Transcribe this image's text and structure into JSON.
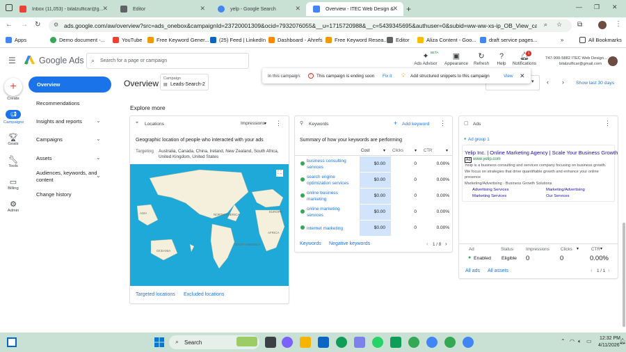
{
  "browser": {
    "tabs": [
      {
        "title": "Inbox (11,053) - bilalzulficar@g...",
        "color": "#ea4335"
      },
      {
        "title": "Editor",
        "color": "#5f6368"
      },
      {
        "title": "yelp - Google Search",
        "color": "#4285f4"
      },
      {
        "title": "Overview - ITEC Web Design &...",
        "color": "#4285f4"
      }
    ],
    "url": "ads.google.com/aw/overview?src=ads_onebox&campaignId=23720001309&ocid=7932076055&__u=1715720988&__c=5439345695&authuser=0&subid=ww-ww-xs-ip_OB_View_campaign",
    "bookmarks": [
      {
        "label": "Apps",
        "color": "#4285f4"
      },
      {
        "label": "Demo document -...",
        "color": "#34a853"
      },
      {
        "label": "YouTube",
        "color": "#ea4335"
      },
      {
        "label": "Free Keyword Gener...",
        "color": "#f29900"
      },
      {
        "label": "(25) Feed | LinkedIn",
        "color": "#0a66c2"
      },
      {
        "label": "Dashboard - Ahrefs",
        "color": "#ff8800"
      },
      {
        "label": "Free Keyword Resea...",
        "color": "#f29900"
      },
      {
        "label": "Editor",
        "color": "#5f6368"
      },
      {
        "label": "Aliza Content - Goo...",
        "color": "#fbbc04"
      },
      {
        "label": "draft service pages...",
        "color": "#4285f4"
      }
    ],
    "all_bookmarks": "All Bookmarks"
  },
  "app": {
    "logo_text": "Google Ads",
    "search_placeholder": "Search for a page or campaign",
    "header_buttons": [
      {
        "label": "Ads Advisor",
        "badge": "BETA",
        "icon": "sparkle-icon"
      },
      {
        "label": "Appearance",
        "icon": "appearance-icon"
      },
      {
        "label": "Refresh",
        "icon": "refresh-icon"
      },
      {
        "label": "Help",
        "icon": "help-icon"
      },
      {
        "label": "Notifications",
        "icon": "bell-icon",
        "count": "1"
      }
    ],
    "account": {
      "line1": "747-900-5882 ITEC Web Design...",
      "line2": "bilalzulficar@gmail.com"
    }
  },
  "leftnav": {
    "icons": [
      {
        "label": "Create",
        "icon": "plus-icon"
      },
      {
        "label": "Campaigns",
        "icon": "megaphone-icon"
      },
      {
        "label": "Goals",
        "icon": "trophy-icon"
      },
      {
        "label": "Tools",
        "icon": "wrench-icon"
      },
      {
        "label": "Billing",
        "icon": "card-icon"
      },
      {
        "label": "Admin",
        "icon": "gear-icon"
      }
    ],
    "menu": [
      {
        "label": "Overview",
        "active": true
      },
      {
        "label": "Recommendations"
      },
      {
        "label": "Insights and reports"
      },
      {
        "label": "Campaigns"
      },
      {
        "label": "Assets"
      },
      {
        "label": "Audiences, keywords, and content"
      },
      {
        "label": "Change history"
      }
    ]
  },
  "page": {
    "title": "Overview",
    "campaign_label": "Campaign",
    "campaign_name": "Leads-Search-2",
    "alert_prefix": "In this campaign:",
    "alert_warning": "This campaign is ending soon",
    "alert_fix": "Fix it",
    "alert_tip": "Add structured snippets to this campaign",
    "alert_view": "View",
    "date_range": "Show last 30 days",
    "explore_more": "Explore more"
  },
  "locations": {
    "header": "Locations",
    "metric": "Impressions",
    "title": "Geographic location of people who interacted with your ads",
    "targeting_label": "Targeting",
    "targeting_value": "Australia, Canada, China, Ireland, New Zealand, South Africa, United Kingdom, United States",
    "map_labels": [
      "NORTH AMERICA",
      "SOUTH AMERICA",
      "EUROPE",
      "AFRICA",
      "ASIA",
      "OCEANIA"
    ],
    "footer_links": [
      "Targeted locations",
      "Excluded locations"
    ]
  },
  "keywords": {
    "header": "Keywords",
    "add": "Add keyword",
    "title": "Summary of how your keywords are performing",
    "columns": [
      "Cost",
      "Clicks",
      "CTR"
    ],
    "rows": [
      {
        "keyword": "business consulting services",
        "cost": "$0.00",
        "clicks": "0",
        "ctr": "0.00%"
      },
      {
        "keyword": "search engine optimization services",
        "cost": "$0.00",
        "clicks": "0",
        "ctr": "0.00%"
      },
      {
        "keyword": "online business marketing",
        "cost": "$0.00",
        "clicks": "0",
        "ctr": "0.00%"
      },
      {
        "keyword": "online marketing services",
        "cost": "$0.00",
        "clicks": "0",
        "ctr": "0.00%"
      },
      {
        "keyword": "internet marketing",
        "cost": "$0.00",
        "clicks": "0",
        "ctr": "0.00%"
      }
    ],
    "footer_links": [
      "Keywords",
      "Negative keywords"
    ],
    "pagination": "1 / 8"
  },
  "ads": {
    "header": "Ads",
    "ad_group": "Ad group 1",
    "headline": "Yelip Inc. | Online Marketing Agency | Scale Your Business Growth",
    "ad_badge": "Ad",
    "display_url": "www.yelip.com",
    "description": "Yelip is a business consulting and services company focusing on business growth. We focus on strategies that drive quantifiable growth and enhance your online presence",
    "breadcrumb": "Marketing/Advertising · Business Growth Solutions",
    "sitelinks": [
      "Advertising Services",
      "Marketing/Advertising",
      "Marketing Services",
      "Our Services"
    ],
    "columns": [
      "Ad",
      "Status",
      "Impressions",
      "Clicks",
      "CTR"
    ],
    "row": {
      "ad": "Enabled",
      "status": "Eligible",
      "impressions": "0",
      "clicks": "0",
      "ctr": "0.00%"
    },
    "footer_links": [
      "All ads",
      "All assets"
    ],
    "pagination": "1 / 1"
  },
  "taskbar": {
    "search": "Search",
    "time": "12:32 PM",
    "date": "4/11/2026",
    "app_colors": [
      "#0078d4",
      "#3c4043",
      "#7b61ff",
      "#f4b400",
      "#0a66c2",
      "#0f9d58",
      "#7b83eb",
      "#25d366",
      "#0f9d58",
      "#34a853",
      "#4285f4",
      "#34a853"
    ]
  }
}
